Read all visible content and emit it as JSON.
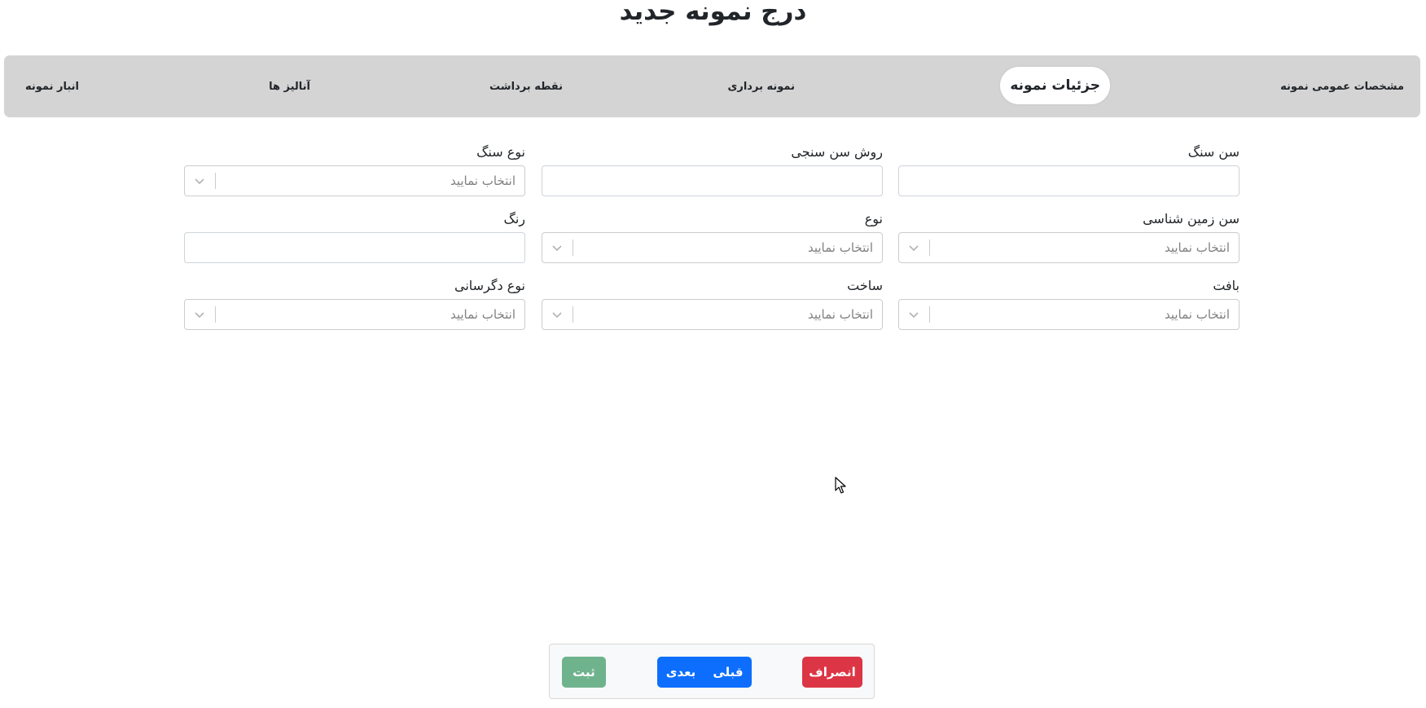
{
  "page": {
    "title": "درج نمونه جدید"
  },
  "stepper": {
    "steps": [
      {
        "label": "مشخصات عمومی نمونه",
        "active": false
      },
      {
        "label": "جزئیات نمونه",
        "active": true
      },
      {
        "label": "نمونه برداری",
        "active": false
      },
      {
        "label": "نقطه برداشت",
        "active": false
      },
      {
        "label": "آنالیز ها",
        "active": false
      },
      {
        "label": "انبار نمونه",
        "active": false
      }
    ]
  },
  "form": {
    "rock_age": {
      "label": "سن سنگ",
      "value": ""
    },
    "dating_method": {
      "label": "روش سن سنجی",
      "value": ""
    },
    "rock_type": {
      "label": "نوع سنگ",
      "placeholder": "انتخاب نمایید"
    },
    "geological_age": {
      "label": "سن زمین شناسی",
      "placeholder": "انتخاب نمایید"
    },
    "type": {
      "label": "نوع",
      "placeholder": "انتخاب نمایید"
    },
    "color": {
      "label": "رنگ",
      "value": ""
    },
    "texture": {
      "label": "بافت",
      "placeholder": "انتخاب نمایید"
    },
    "structure": {
      "label": "ساخت",
      "placeholder": "انتخاب نمایید"
    },
    "alteration_type": {
      "label": "نوع دگرسانی",
      "placeholder": "انتخاب نمایید"
    }
  },
  "footer": {
    "submit_label": "ثبت",
    "next_label": "بعدی",
    "prev_label": "قبلی",
    "cancel_label": "انصراف"
  },
  "colors": {
    "stepper_bg": "#d4d4d4",
    "submit": "#6fb38d",
    "primary": "#0d6efd",
    "danger": "#dc3545"
  }
}
